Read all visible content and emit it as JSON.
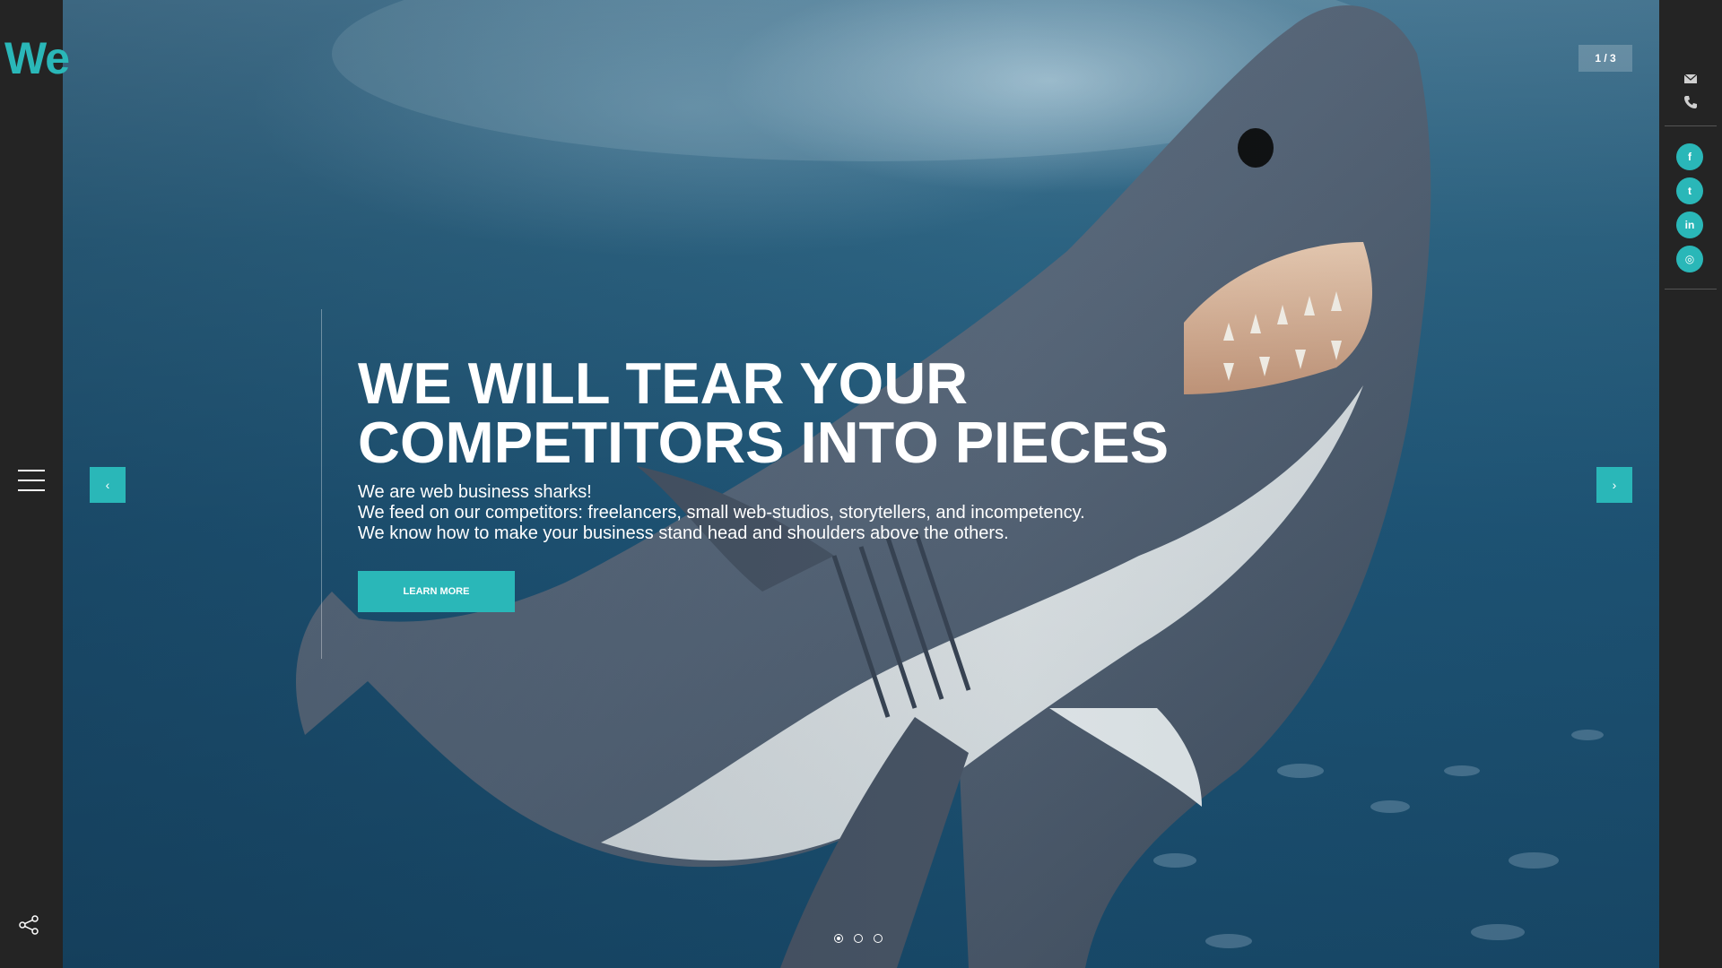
{
  "brand": {
    "logo_text": "We",
    "accent_color": "#2ab7b8",
    "sidebar_color": "#242424"
  },
  "nav": {
    "menu_icon": "hamburger-menu-icon",
    "share_icon": "share-icon"
  },
  "slider": {
    "counter": "1 / 3",
    "prev_label": "‹",
    "next_label": "›",
    "slide_count": 3,
    "active_slide": 1
  },
  "hero": {
    "headline": [
      "WE WILL TEAR YOUR",
      "COMPETITORS INTO PIECES"
    ],
    "subtext": [
      "We are web business sharks!",
      "We feed on our competitors: freelancers, small web-studios, storytellers, and incompetency.",
      "We know how to make your business stand head and shoulders above the others."
    ],
    "cta_label": "LEARN MORE"
  },
  "contact": {
    "mail_icon": "envelope-icon",
    "phone_icon": "phone-icon"
  },
  "social": [
    {
      "name": "facebook",
      "glyph": "f"
    },
    {
      "name": "twitter",
      "glyph": "t"
    },
    {
      "name": "linkedin",
      "glyph": "in"
    },
    {
      "name": "instagram",
      "glyph": "◎"
    }
  ]
}
